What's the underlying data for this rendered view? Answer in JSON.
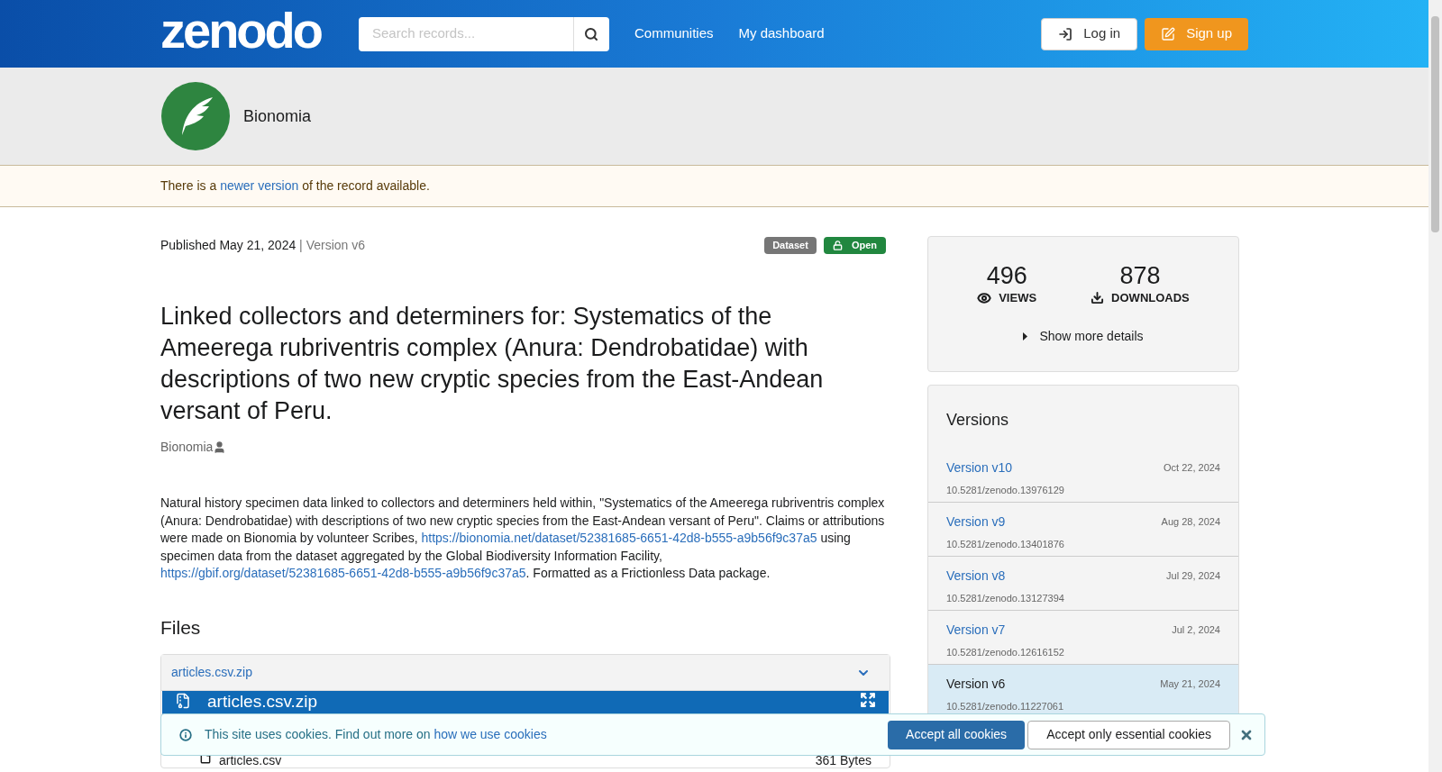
{
  "header": {
    "logo": "zenodo",
    "search": {
      "placeholder": "Search records..."
    },
    "nav": [
      "Communities",
      "My dashboard"
    ],
    "login": "Log in",
    "signup": "Sign up"
  },
  "community": {
    "name": "Bionomia"
  },
  "notice": [
    {
      "kind": "text",
      "text": "There is a "
    },
    {
      "kind": "link",
      "text": "newer version"
    },
    {
      "kind": "text",
      "text": " of the record available."
    }
  ],
  "record": {
    "published": "Published May 21, 2024",
    "separator": "|",
    "version": "Version v6",
    "badges": [
      {
        "kind": "type",
        "label": "Dataset"
      },
      {
        "kind": "access",
        "label": "Open"
      }
    ],
    "title": "Linked collectors and determiners for: Systematics of the Ameerega rubriventris complex (Anura: Dendrobatidae) with descriptions of two new cryptic species from the East-Andean versant of Peru.",
    "creator": "Bionomia",
    "description": [
      {
        "kind": "text",
        "text": "Natural history specimen data linked to collectors and determiners held within, \"Systematics of the Ameerega rubriventris complex (Anura: Dendrobatidae) with descriptions of two new cryptic species from the East-Andean versant of Peru\". Claims or attributions were made on Bionomia by volunteer Scribes, "
      },
      {
        "kind": "link",
        "text": "https://bionomia.net/dataset/52381685-6651-42d8-b555-a9b56f9c37a5"
      },
      {
        "kind": "text",
        "text": " using specimen data from the dataset aggregated by the Global Biodiversity Information Facility, "
      },
      {
        "kind": "link",
        "text": "https://gbif.org/dataset/52381685-6651-42d8-b555-a9b56f9c37a5"
      },
      {
        "kind": "text",
        "text": ". Formatted as a Frictionless Data package."
      }
    ]
  },
  "files": {
    "heading": "Files",
    "archive": "articles.csv.zip",
    "preview_title": "articles.csv.zip",
    "entries": [
      {
        "name": "articles.csv",
        "size": "361 Bytes"
      }
    ]
  },
  "stats": {
    "views": "496",
    "views_label": "VIEWS",
    "downloads": "878",
    "downloads_label": "DOWNLOADS",
    "more": "Show more details"
  },
  "versions": {
    "heading": "Versions",
    "items": [
      {
        "label": "Version v10",
        "date": "Oct 22, 2024",
        "doi": "10.5281/zenodo.13976129",
        "selected": false
      },
      {
        "label": "Version v9",
        "date": "Aug 28, 2024",
        "doi": "10.5281/zenodo.13401876",
        "selected": false
      },
      {
        "label": "Version v8",
        "date": "Jul 29, 2024",
        "doi": "10.5281/zenodo.13127394",
        "selected": false
      },
      {
        "label": "Version v7",
        "date": "Jul 2, 2024",
        "doi": "10.5281/zenodo.12616152",
        "selected": false
      },
      {
        "label": "Version v6",
        "date": "May 21, 2024",
        "doi": "10.5281/zenodo.11227061",
        "selected": true
      }
    ]
  },
  "cookies": {
    "message": "This site uses cookies. Find out more on ",
    "link": "how we use cookies",
    "accept_all": "Accept all cookies",
    "accept_essential": "Accept only essential cookies"
  }
}
